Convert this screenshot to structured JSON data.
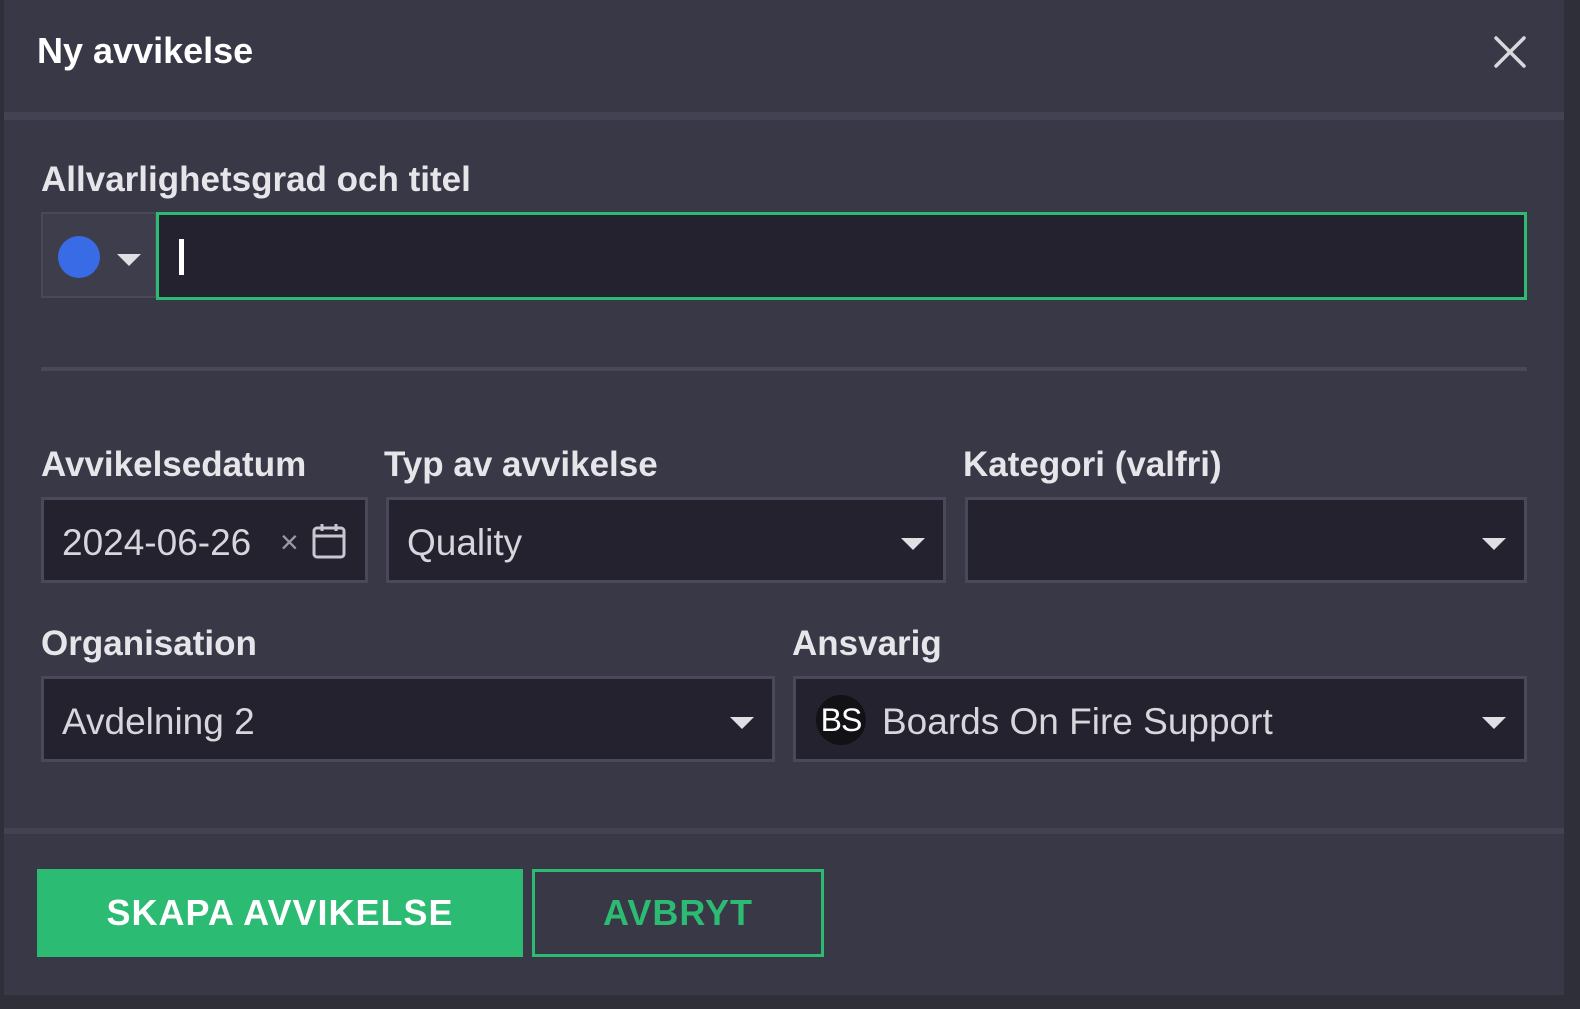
{
  "dialog": {
    "title": "Ny avvikelse",
    "close_icon": "close-icon"
  },
  "severity_title": {
    "label": "Allvarlighetsgrad och titel",
    "severity_color": "#3a6be6",
    "title_value": ""
  },
  "date": {
    "label": "Avvikelsedatum",
    "value": "2024-06-26",
    "clear_glyph": "×"
  },
  "type": {
    "label": "Typ av avvikelse",
    "value": "Quality"
  },
  "category": {
    "label": "Kategori (valfri)",
    "value": ""
  },
  "organisation": {
    "label": "Organisation",
    "value": "Avdelning 2"
  },
  "responsible": {
    "label": "Ansvarig",
    "avatar_initials": "BS",
    "value": "Boards On Fire Support"
  },
  "actions": {
    "create_label": "SKAPA AVVIKELSE",
    "cancel_label": "AVBRYT"
  },
  "colors": {
    "accent": "#2bbb73",
    "background": "#393846",
    "input_background": "#23222e"
  }
}
